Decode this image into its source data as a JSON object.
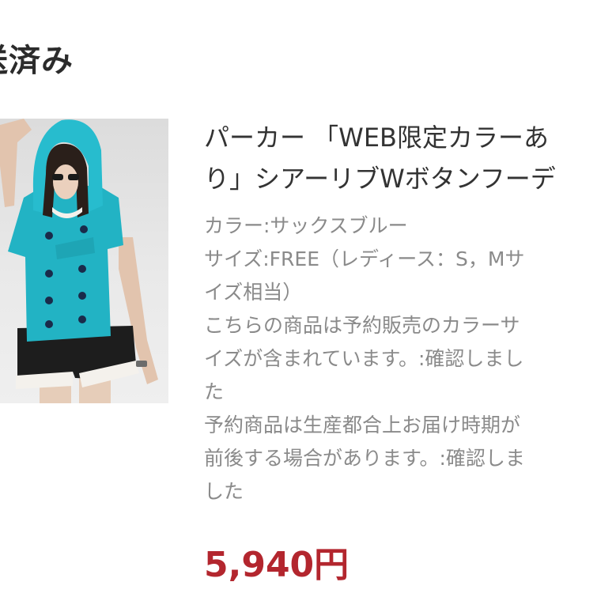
{
  "status": {
    "heading": "送済み"
  },
  "product": {
    "image_icon": "product-photo",
    "title_lines": [
      "パーカー 「WEB限定カラーあ",
      "り」シアーリブWボタンフーデ"
    ],
    "details_lines": [
      "カラー:サックスブルー",
      "サイズ:FREE（レディース：S，Mサ",
      "イズ相当）",
      "こちらの商品は予約販売のカラーサ",
      "イズが含まれています。:確認しまし",
      "た",
      "予約商品は生産都合上お届け時期が",
      "前後する場合があります。:確認しま",
      "した"
    ],
    "price": "5,940円"
  },
  "colors": {
    "heading": "#2b2b2b",
    "title": "#333333",
    "details": "#8a8a8a",
    "price": "#b3262e",
    "hoodie": "#22b3c4"
  }
}
